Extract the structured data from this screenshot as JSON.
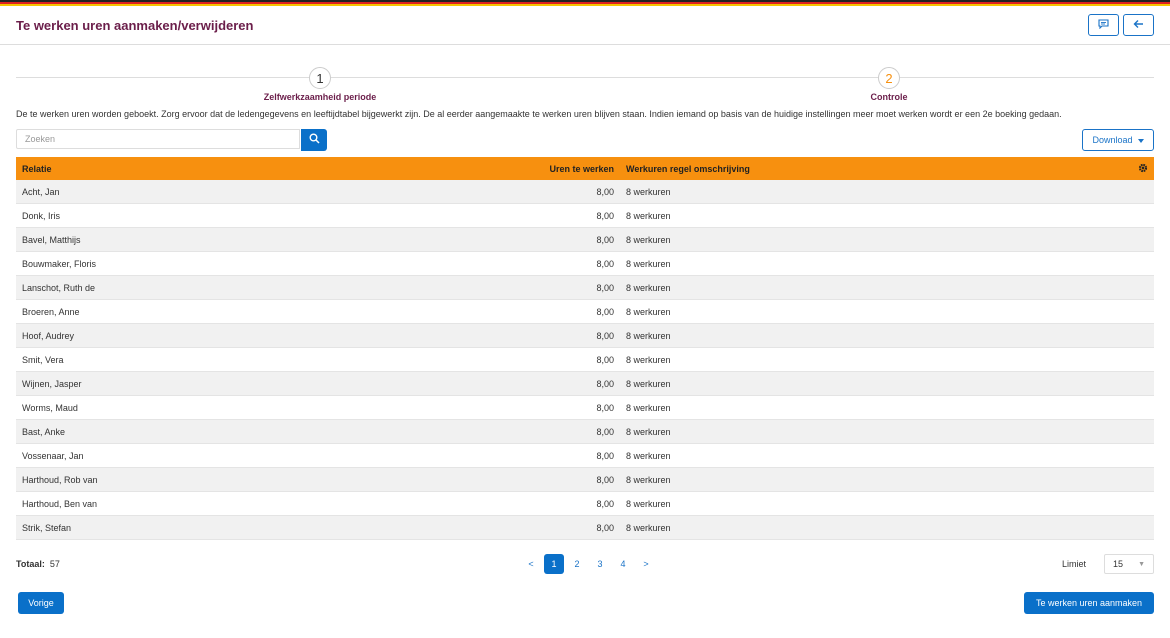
{
  "page": {
    "title": "Te werken uren aanmaken/verwijderen"
  },
  "steps": [
    {
      "number": "1",
      "label": "Zelfwerkzaamheid periode"
    },
    {
      "number": "2",
      "label": "Controle"
    }
  ],
  "description": "De te werken uren worden geboekt. Zorg ervoor dat de ledengegevens en leeftijdtabel bijgewerkt zijn. De al eerder aangemaakte te werken uren blijven staan. Indien iemand op basis van de huidige instellingen meer moet werken wordt er een 2e boeking gedaan.",
  "search": {
    "placeholder": "Zoeken",
    "value": ""
  },
  "download_label": "Download",
  "table": {
    "headers": {
      "relatie": "Relatie",
      "uren": "Uren te werken",
      "omschrijving": "Werkuren regel omschrijving"
    },
    "rows": [
      {
        "relatie": "Acht, Jan",
        "uren": "8,00",
        "omschrijving": "8 werkuren"
      },
      {
        "relatie": "Donk, Iris",
        "uren": "8,00",
        "omschrijving": "8 werkuren"
      },
      {
        "relatie": "Bavel, Matthijs",
        "uren": "8,00",
        "omschrijving": "8 werkuren"
      },
      {
        "relatie": "Bouwmaker, Floris",
        "uren": "8,00",
        "omschrijving": "8 werkuren"
      },
      {
        "relatie": "Lanschot, Ruth de",
        "uren": "8,00",
        "omschrijving": "8 werkuren"
      },
      {
        "relatie": "Broeren, Anne",
        "uren": "8,00",
        "omschrijving": "8 werkuren"
      },
      {
        "relatie": "Hoof, Audrey",
        "uren": "8,00",
        "omschrijving": "8 werkuren"
      },
      {
        "relatie": "Smit, Vera",
        "uren": "8,00",
        "omschrijving": "8 werkuren"
      },
      {
        "relatie": "Wijnen, Jasper",
        "uren": "8,00",
        "omschrijving": "8 werkuren"
      },
      {
        "relatie": "Worms, Maud",
        "uren": "8,00",
        "omschrijving": "8 werkuren"
      },
      {
        "relatie": "Bast, Anke",
        "uren": "8,00",
        "omschrijving": "8 werkuren"
      },
      {
        "relatie": "Vossenaar, Jan",
        "uren": "8,00",
        "omschrijving": "8 werkuren"
      },
      {
        "relatie": "Harthoud, Rob van",
        "uren": "8,00",
        "omschrijving": "8 werkuren"
      },
      {
        "relatie": "Harthoud, Ben van",
        "uren": "8,00",
        "omschrijving": "8 werkuren"
      },
      {
        "relatie": "Strik, Stefan",
        "uren": "8,00",
        "omschrijving": "8 werkuren"
      }
    ]
  },
  "footer": {
    "total_label": "Totaal:",
    "total_value": "57",
    "pagination": {
      "prev": "<",
      "pages": [
        "1",
        "2",
        "3",
        "4"
      ],
      "next": ">",
      "current": "1"
    },
    "limit_label": "Limiet",
    "limit_value": "15"
  },
  "buttons": {
    "previous": "Vorige",
    "create": "Te werken uren aanmaken"
  },
  "colors": {
    "accent": "#0a70c9",
    "header_row": "#f7900f",
    "title": "#6b1e4a",
    "step2_number": "#f7900f"
  },
  "icons": {
    "comment": "comment-icon",
    "back": "arrow-left-icon",
    "search": "search-icon",
    "settings": "gear-icon",
    "caret": "caret-down-icon"
  }
}
